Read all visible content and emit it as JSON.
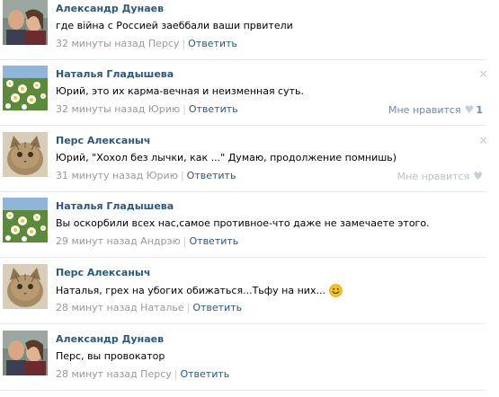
{
  "comments": [
    {
      "author": "Александр Дунаев",
      "text": "где війна с Россией заеббали ваши првители",
      "time": "32 минуты назад Персу",
      "reply": "Ответить",
      "avatar": "couple-photo"
    },
    {
      "author": "Наталья Гладышева",
      "text": "Юрий, это их карма-вечная и неизменная суть.",
      "time": "32 минуты назад Юрию",
      "reply": "Ответить",
      "like_label": "Мне нравится",
      "like_count": "1",
      "avatar": "daisies-photo"
    },
    {
      "author": "Перс Алексаныч",
      "text": "Юрий, \"Хохол без лычки, как ...\" Думаю, продолжение помнишь)",
      "time": "31 минуту назад Юрию",
      "reply": "Ответить",
      "like_label": "Мне нравится",
      "avatar": "kitten-photo"
    },
    {
      "author": "Наталья Гладышева",
      "text": "Вы оскорбили всех нас,самое противное-что даже не замечаете этого.",
      "time": "29 минут назад Андрэю",
      "reply": "Ответить",
      "avatar": "daisies-photo"
    },
    {
      "author": "Перс Алексаныч",
      "text": "Наталья, грех на убогих обижаться...Тьфу на них...",
      "time": "28 минут назад Наталье",
      "reply": "Ответить",
      "emoji": "smile-emoji",
      "avatar": "kitten-photo"
    },
    {
      "author": "Александр Дунаев",
      "text": "Перс, вы провокатор",
      "time": "28 минут назад Персу",
      "reply": "Ответить",
      "avatar": "couple-photo"
    }
  ],
  "colors": {
    "link": "#2b587a",
    "meta": "#999999",
    "divider": "#e7eaed"
  }
}
